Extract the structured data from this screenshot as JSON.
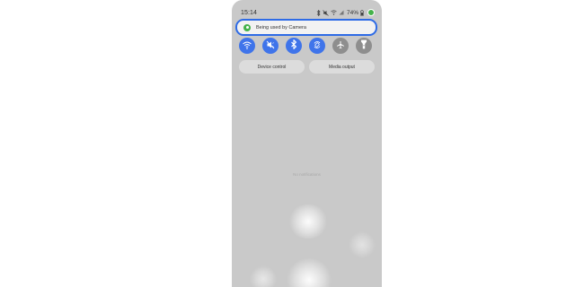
{
  "status_bar": {
    "time": "15:14",
    "battery": "74%",
    "icons": [
      "bluetooth-icon",
      "mute-icon",
      "wifi-icon",
      "signal-icon",
      "battery-icon",
      "camera-in-use-icon"
    ]
  },
  "privacy_indicator": {
    "text": "Being used by Camera",
    "icon": "camera-in-use-dot-icon",
    "color": "#44b24a",
    "highlight_color": "#2e6be6"
  },
  "quick_settings": [
    {
      "name": "wifi",
      "icon": "wifi-icon",
      "active": true
    },
    {
      "name": "sound",
      "icon": "mute-icon",
      "active": true
    },
    {
      "name": "bluetooth",
      "icon": "bluetooth-icon",
      "active": true
    },
    {
      "name": "auto-rotate",
      "icon": "auto-rotate-icon",
      "active": true
    },
    {
      "name": "airplane-mode",
      "icon": "airplane-icon",
      "active": false
    },
    {
      "name": "flashlight",
      "icon": "flashlight-icon",
      "active": false
    }
  ],
  "controls": {
    "device_control": "Device control",
    "media_output": "Media output"
  },
  "notifications": {
    "empty_text": "No notifications"
  },
  "colors": {
    "active_tile": "#3f74ea",
    "inactive_tile": "#8e8e8e",
    "panel_background": "#c9c9c9"
  }
}
